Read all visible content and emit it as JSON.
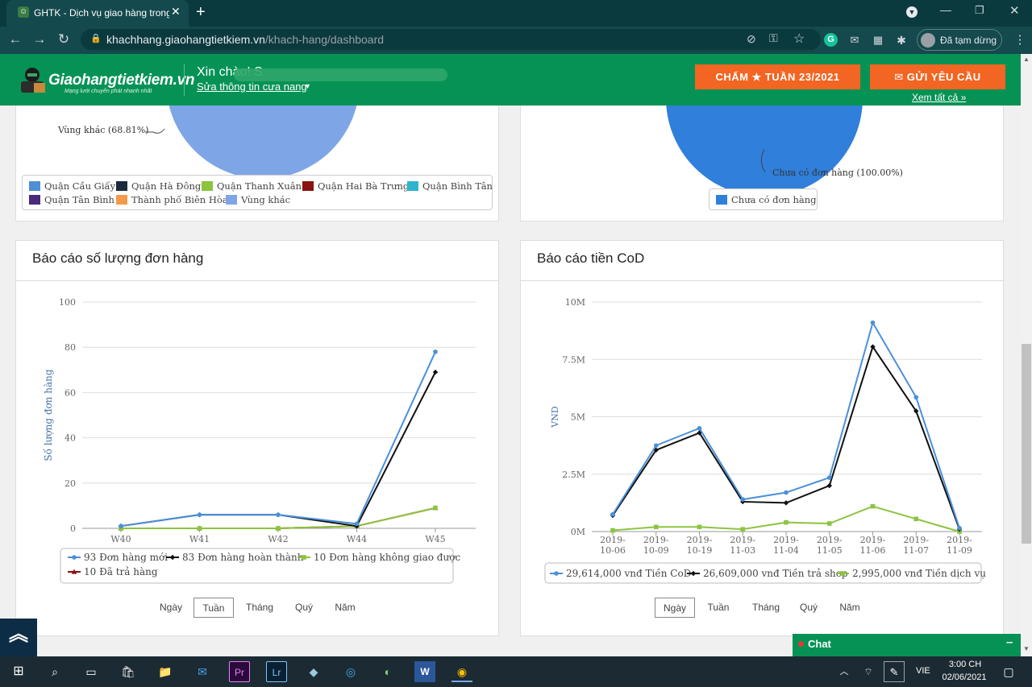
{
  "browser": {
    "tab_title": "GHTK - Dịch vụ giao hàng trong",
    "url_host": "khachhang.giaohangtietkiem.vn",
    "url_path": "/khach-hang/dashboard",
    "paused_label": "Đã tạm dừng"
  },
  "header": {
    "logo_text": "Giaohangtietkiem.vn",
    "logo_tagline": "Mạng lưới chuyển phát nhanh nhất",
    "greeting": "Xin chào! S",
    "edit_link": "Sửa thông tin cưa nang",
    "rating_button": "CHẤM ★ TUẦN 23/2021",
    "request_button": "GỬI YÊU CẦU",
    "see_all": "Xem tất cả »"
  },
  "left_pie": {
    "slice_label": "Vùng khác (68.81%)",
    "legend": [
      {
        "label": "Quận Cầu Giấy",
        "color": "#4f8fd4"
      },
      {
        "label": "Quận Hà Đông",
        "color": "#1b2b3d"
      },
      {
        "label": "Quận Thanh Xuân",
        "color": "#8cc43f"
      },
      {
        "label": "Quận Hai Bà Trưng",
        "color": "#8a1111"
      },
      {
        "label": "Quận Bình Tân",
        "color": "#2eb4cf"
      },
      {
        "label": "Quận Tân Bình",
        "color": "#4a2a7a"
      },
      {
        "label": "Thành phố Biên Hòa",
        "color": "#f59a4b"
      },
      {
        "label": "Vùng khác",
        "color": "#7ea6e6"
      }
    ]
  },
  "right_pie": {
    "slice_label": "Chưa có đơn hàng (100.00%)",
    "legend": [
      {
        "label": "Chưa có đơn hàng",
        "color": "#2f7fdb"
      }
    ]
  },
  "orders_card": {
    "title": "Báo cáo số lượng đơn hàng",
    "periods": [
      "Ngày",
      "Tuần",
      "Tháng",
      "Quý",
      "Năm"
    ],
    "selected_period": "Tuần"
  },
  "cod_card": {
    "title": "Báo cáo tiền CoD",
    "periods": [
      "Ngày",
      "Tuần",
      "Tháng",
      "Quý",
      "Năm"
    ],
    "selected_period": "Ngày"
  },
  "chat_label": "Chat",
  "taskbar": {
    "time": "3:00 CH",
    "date": "02/06/2021",
    "lang": "VIE"
  },
  "chart_data": [
    {
      "type": "line",
      "ylabel": "Số lượng đơn hàng",
      "xlabel": "",
      "categories": [
        "W40",
        "W41",
        "W42",
        "W44",
        "W45"
      ],
      "ylim": [
        0,
        100
      ],
      "yticks": [
        0,
        20,
        40,
        60,
        80,
        100
      ],
      "grid": true,
      "legend_position": "bottom",
      "series": [
        {
          "name": "93 Đơn hàng mới",
          "color": "#4a90d9",
          "marker": "circle",
          "values": [
            1,
            6,
            6,
            2,
            78
          ]
        },
        {
          "name": "83 Đơn hàng hoàn thành",
          "color": "#111111",
          "marker": "diamond",
          "values": [
            1,
            6,
            6,
            1,
            69
          ]
        },
        {
          "name": "10 Đơn hàng không giao được",
          "color": "#8cc43f",
          "marker": "square",
          "values": [
            0,
            0,
            0,
            1,
            9
          ]
        },
        {
          "name": "10 Đã trả hàng",
          "color": "#8a1111",
          "marker": "triangle",
          "values": [
            0,
            0,
            0,
            1,
            9
          ]
        }
      ]
    },
    {
      "type": "line",
      "ylabel": "VND",
      "xlabel": "",
      "categories": [
        "2019-10-06",
        "2019-10-09",
        "2019-10-19",
        "2019-11-03",
        "2019-11-04",
        "2019-11-05",
        "2019-11-06",
        "2019-11-07",
        "2019-11-09"
      ],
      "ylim": [
        0,
        10000000
      ],
      "yticks": [
        0,
        2500000,
        5000000,
        7500000,
        10000000
      ],
      "ytick_labels": [
        "0M",
        "2.5M",
        "5M",
        "7.5M",
        "10M"
      ],
      "grid": true,
      "legend_position": "bottom",
      "series": [
        {
          "name": "29,614,000 vnđ Tiền CoD",
          "color": "#4a90d9",
          "marker": "circle",
          "values": [
            750000,
            3750000,
            4500000,
            1400000,
            1700000,
            2350000,
            9100000,
            5850000,
            150000
          ]
        },
        {
          "name": "26,609,000 vnđ Tiền trả shop",
          "color": "#111111",
          "marker": "diamond",
          "values": [
            700000,
            3550000,
            4300000,
            1300000,
            1250000,
            2000000,
            8050000,
            5250000,
            100000
          ]
        },
        {
          "name": "2,995,000 vnđ Tiền dịch vụ",
          "color": "#8cc43f",
          "marker": "square",
          "values": [
            50000,
            200000,
            200000,
            100000,
            400000,
            350000,
            1100000,
            550000,
            0
          ]
        }
      ]
    }
  ]
}
